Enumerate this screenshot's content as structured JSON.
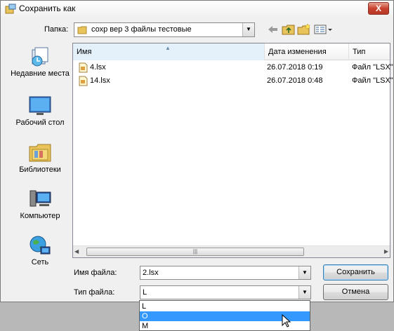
{
  "window": {
    "title": "Сохранить как",
    "close_label": "X"
  },
  "lookin": {
    "label": "Папка:",
    "value": "сохр вер 3 файлы тестовые"
  },
  "places": [
    {
      "label": "Недавние места",
      "icon": "recent-places-icon"
    },
    {
      "label": "Рабочий стол",
      "icon": "desktop-icon"
    },
    {
      "label": "Библиотеки",
      "icon": "libraries-icon"
    },
    {
      "label": "Компьютер",
      "icon": "computer-icon"
    },
    {
      "label": "Сеть",
      "icon": "network-icon"
    }
  ],
  "filelist": {
    "columns": [
      "Имя",
      "Дата изменения",
      "Тип"
    ],
    "rows": [
      {
        "name": "4.lsx",
        "date": "26.07.2018 0:19",
        "type": "Файл \"LSX\""
      },
      {
        "name": "14.lsx",
        "date": "26.07.2018 0:48",
        "type": "Файл \"LSX\""
      }
    ]
  },
  "filename": {
    "label": "Имя файла:",
    "value": "2.lsx"
  },
  "filetype": {
    "label": "Тип файла:",
    "value": "L",
    "options": [
      "L",
      "O",
      "M"
    ],
    "highlighted_index": 1
  },
  "buttons": {
    "save": "Сохранить",
    "cancel": "Отмена"
  },
  "colors": {
    "highlight": "#3399ff",
    "folder": "#e8c45a"
  }
}
